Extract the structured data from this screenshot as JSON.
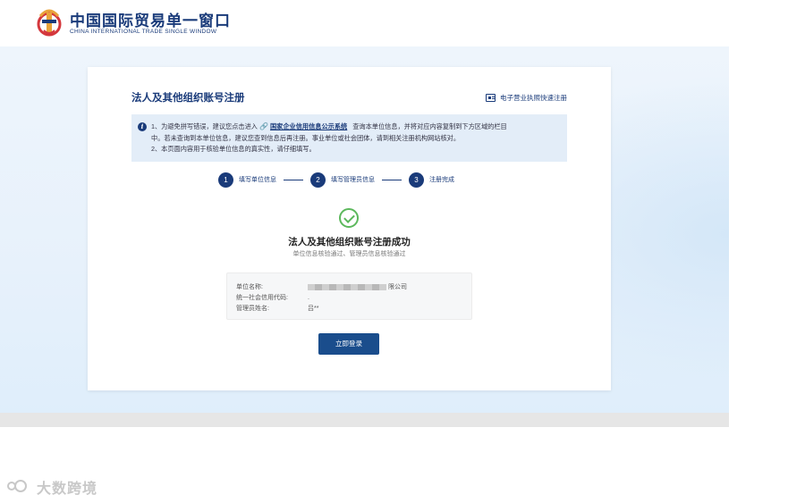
{
  "header": {
    "brand_cn": "中国国际贸易单一窗口",
    "brand_en": "CHINA INTERNATIONAL TRADE SINGLE WINDOW"
  },
  "card": {
    "title": "法人及其他组织账号注册",
    "quick_link": "电子营业执照快速注册",
    "notice": {
      "line1_pre": "1、为避免拼写错误，建议您点击进入",
      "line1_link": "国家企业信用信息公示系统",
      "line1_post": "查询本单位信息，并将对应内容复制到下方区域的栏目",
      "line2": "中。若未查询到本单位信息，建议您查到信息后再注册。事业单位或社会团体，请到相关注册机构网站核对。",
      "line3": "2、本页面内容用于核验单位信息的真实性，请仔细填写。"
    },
    "steps": [
      {
        "num": "1",
        "label": "填写单位信息"
      },
      {
        "num": "2",
        "label": "填写管理员信息"
      },
      {
        "num": "3",
        "label": "注册完成"
      }
    ],
    "success_title": "法人及其他组织账号注册成功",
    "success_sub": "单位信息核验通过、管理员信息核验通过",
    "info": {
      "unit_name_label": "单位名称:",
      "unit_name_suffix": "限公司",
      "credit_code_label": "统一社会信用代码:",
      "credit_code_value": ".",
      "admin_name_label": "管理员姓名:",
      "admin_name_value": "吕**"
    },
    "login_button": "立即登录"
  },
  "watermark": "大数跨境",
  "colors": {
    "primary": "#1a3b7a",
    "button": "#1a4d8c",
    "success": "#5cb85c",
    "notice_bg": "#e3edf8"
  }
}
